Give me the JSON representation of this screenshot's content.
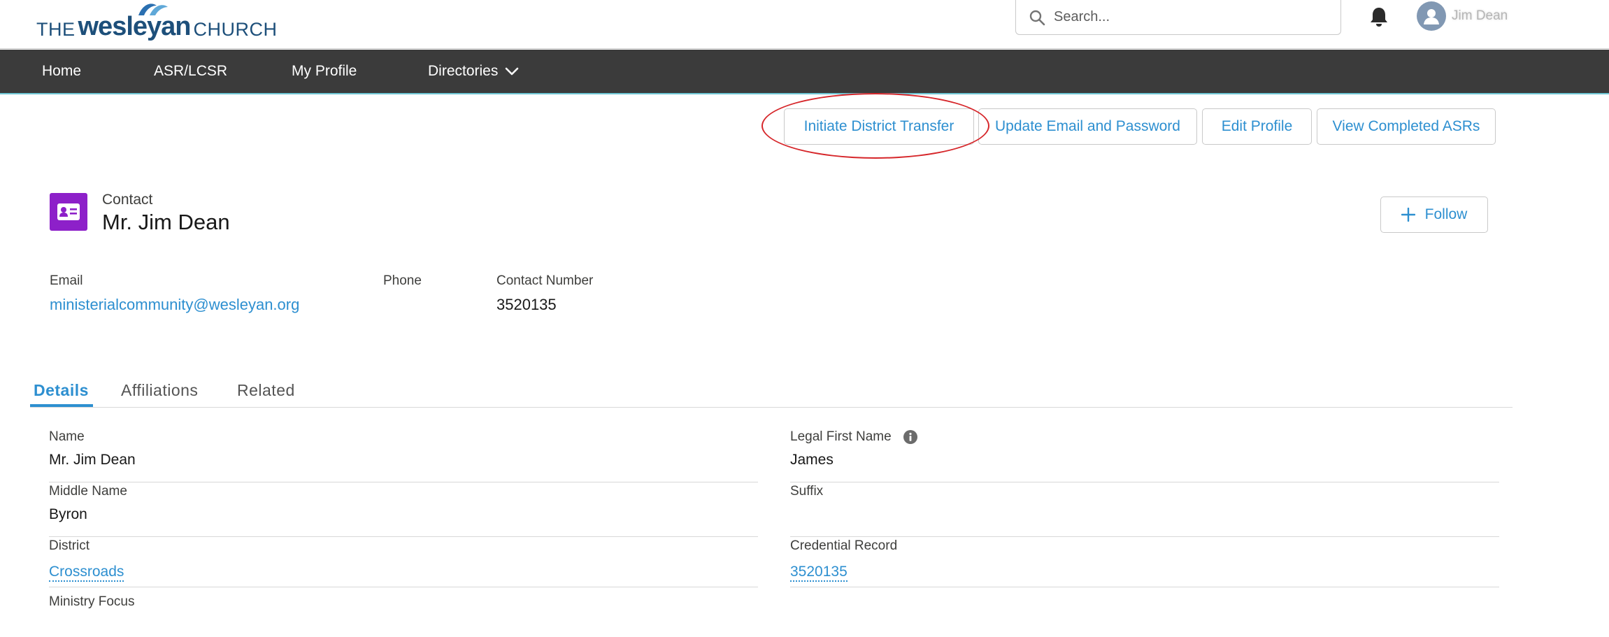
{
  "header": {
    "logo": {
      "the": "THE",
      "wesleyan": "wesleyan",
      "church": "CHURCH"
    },
    "search_placeholder": "Search...",
    "user_name": "Jim Dean"
  },
  "nav": {
    "items": [
      "Home",
      "ASR/LCSR",
      "My Profile",
      "Directories"
    ]
  },
  "actions": {
    "initiate_transfer": "Initiate District Transfer",
    "update_email": "Update Email and Password",
    "edit_profile": "Edit Profile",
    "view_asrs": "View Completed ASRs"
  },
  "record": {
    "type": "Contact",
    "name": "Mr. Jim Dean",
    "follow_label": "Follow",
    "icon_color": "#8d20c9"
  },
  "highlights": {
    "email_label": "Email",
    "email_value": "ministerialcommunity@wesleyan.org",
    "phone_label": "Phone",
    "phone_value": "",
    "contact_number_label": "Contact Number",
    "contact_number_value": "3520135"
  },
  "tabs": [
    "Details",
    "Affiliations",
    "Related"
  ],
  "details": {
    "name_label": "Name",
    "name_value": "Mr. Jim Dean",
    "legal_first_name_label": "Legal First Name",
    "legal_first_name_value": "James",
    "middle_name_label": "Middle Name",
    "middle_name_value": "Byron",
    "suffix_label": "Suffix",
    "suffix_value": "",
    "district_label": "District",
    "district_value": "Crossroads",
    "credential_record_label": "Credential Record",
    "credential_record_value": "3520135",
    "ministry_focus_label": "Ministry Focus"
  },
  "colors": {
    "accent": "#2d8fd0",
    "nav_bg": "#3b3b3b",
    "highlight_ring": "#d6262a"
  }
}
